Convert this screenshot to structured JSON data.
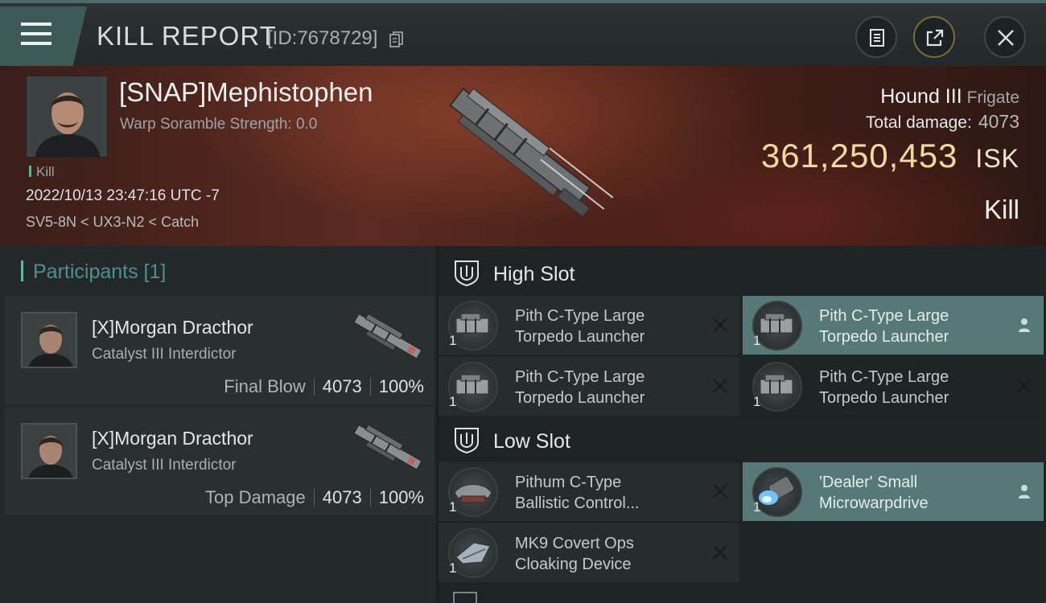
{
  "header": {
    "title": "KILL REPORT",
    "report_id": "[ID:7678729]",
    "icons": [
      "menu-icon",
      "copy-icon",
      "clipboard-icon",
      "share-icon",
      "close-icon"
    ]
  },
  "victim": {
    "name": "[SNAP]Mephistophen",
    "warp_scramble": "Warp Soramble Strength: 0.0",
    "kill_tag": "Kill",
    "datetime": "2022/10/13 23:47:16 UTC -7",
    "route": "SV5-8N < UX3-N2 < Catch",
    "ship": "Hound III",
    "ship_class": "Frigate",
    "total_damage_label": "Total damage:",
    "total_damage": "4073",
    "isk_value": "361,250,453",
    "isk_unit": "ISK",
    "result": "Kill"
  },
  "participants": {
    "heading": "Participants [1]",
    "list": [
      {
        "name": "[X]Morgan Dracthor",
        "ship": "Catalyst III Interdictor",
        "role": "Final Blow",
        "damage": "4073",
        "percent": "100%"
      },
      {
        "name": "[X]Morgan Dracthor",
        "ship": "Catalyst III Interdictor",
        "role": "Top Damage",
        "damage": "4073",
        "percent": "100%"
      }
    ]
  },
  "fitting": {
    "high_slot": {
      "label": "High Slot",
      "modules": [
        {
          "name_line1": "Pith C-Type Large",
          "name_line2": "Torpedo Launcher",
          "qty": "1",
          "state": "destroyed"
        },
        {
          "name_line1": "Pith C-Type Large",
          "name_line2": "Torpedo Launcher",
          "qty": "1",
          "state": "dropped"
        },
        {
          "name_line1": "Pith C-Type Large",
          "name_line2": "Torpedo Launcher",
          "qty": "1",
          "state": "destroyed"
        },
        {
          "name_line1": "Pith C-Type Large",
          "name_line2": "Torpedo Launcher",
          "qty": "1",
          "state": "destroyed"
        }
      ]
    },
    "low_slot": {
      "label": "Low Slot",
      "modules": [
        {
          "name_line1": "Pithum C-Type",
          "name_line2": "Ballistic Control...",
          "qty": "1",
          "state": "destroyed"
        },
        {
          "name_line1": "'Dealer' Small",
          "name_line2": "Microwarpdrive",
          "qty": "1",
          "state": "dropped"
        },
        {
          "name_line1": "MK9 Covert Ops",
          "name_line2": "Cloaking Device",
          "qty": "1",
          "state": "destroyed"
        }
      ]
    }
  },
  "colors": {
    "accent_teal": "#567876",
    "isk_gold": "#f3d9a0",
    "participants_teal": "#4f8f8c"
  }
}
